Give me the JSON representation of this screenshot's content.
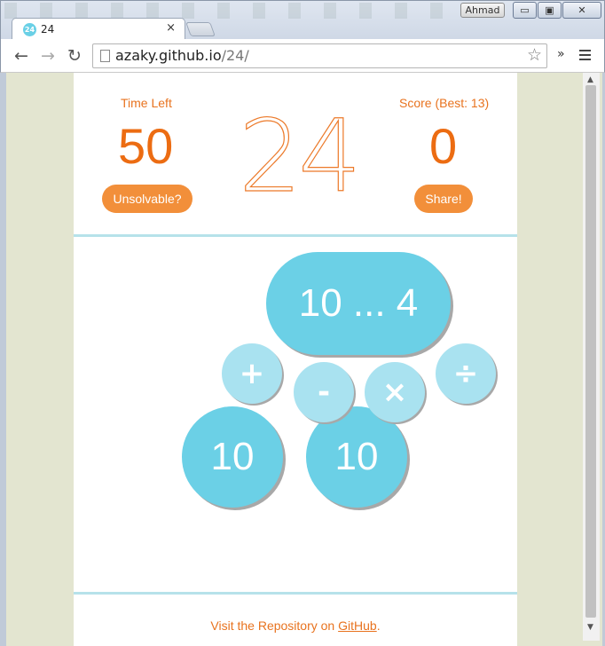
{
  "window": {
    "user": "Ahmad",
    "controls": {
      "minimize": "▭",
      "maximize": "▣",
      "close": "✕"
    }
  },
  "tab": {
    "favicon_text": "24",
    "title": "24",
    "close": "×"
  },
  "toolbar": {
    "back": "←",
    "forward": "→",
    "reload": "↻",
    "url_host": "azaky.github.io",
    "url_path": "/24/",
    "star": "☆",
    "extensions": "»"
  },
  "scrollbar": {
    "up": "▲",
    "down": "▼"
  },
  "game": {
    "time_label": "Time Left",
    "time_value": "50",
    "goal": "24",
    "score_label": "Score (Best: 13)",
    "score_value": "0",
    "unsolvable_label": "Unsolvable?",
    "share_label": "Share!",
    "combined": "10 ... 4",
    "operators": {
      "plus": "+",
      "minus": "-",
      "times": "×",
      "divide": "÷"
    },
    "numbers": [
      "10",
      "10"
    ]
  },
  "footer": {
    "prefix": "Visit the Repository on ",
    "link": "GitHub",
    "suffix": "."
  },
  "colors": {
    "accent": "#ec6c12",
    "ball": "#6bd0e6",
    "operator": "#a9e2f0",
    "divider": "#b6e2ea"
  }
}
